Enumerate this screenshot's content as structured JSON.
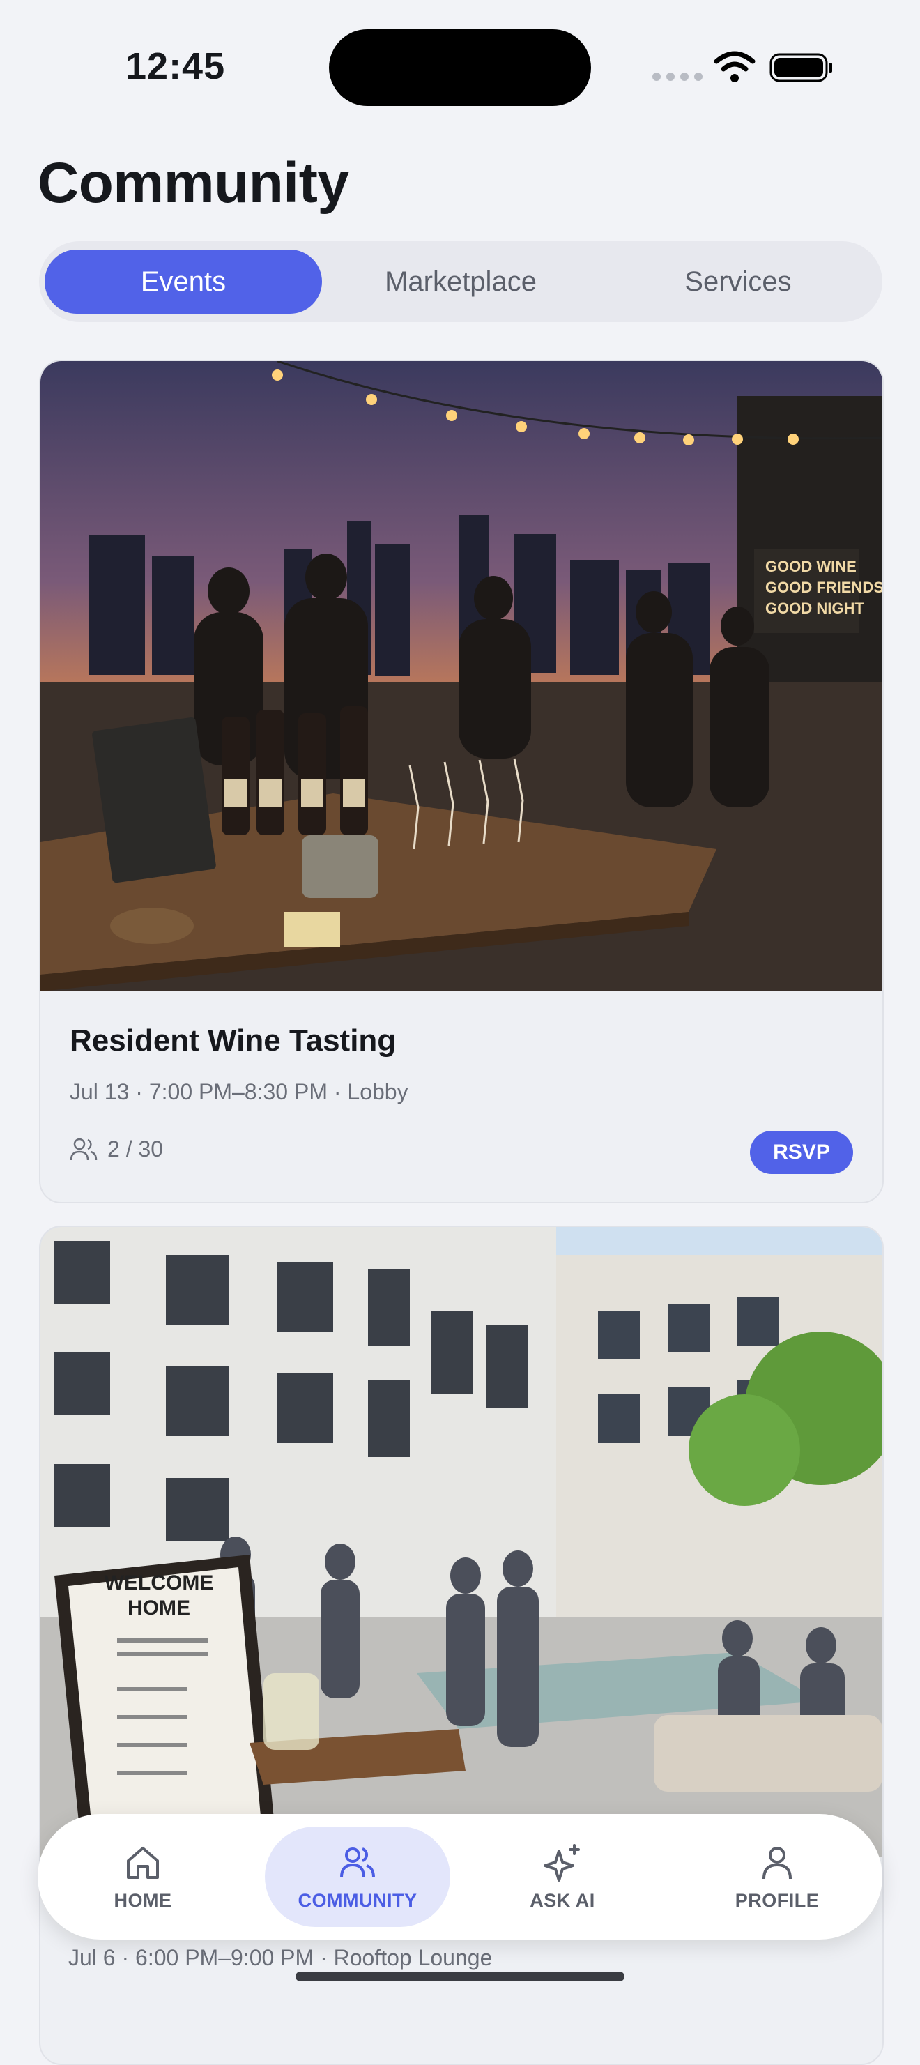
{
  "status_bar": {
    "time": "12:45"
  },
  "page": {
    "title": "Community"
  },
  "tabs": [
    {
      "label": "Events",
      "active": true
    },
    {
      "label": "Marketplace",
      "active": false
    },
    {
      "label": "Services",
      "active": false
    }
  ],
  "events": [
    {
      "title": "Resident Wine Tasting",
      "meta": "Jul 13 · 7:00 PM–8:30 PM · Lobby",
      "attendees": "2 / 30",
      "action": "RSVP",
      "image_text": {
        "sign": [
          "GOOD WINE",
          "GOOD FRIENDS",
          "GOOD NIGHT"
        ]
      }
    },
    {
      "meta": "Jul 6 · 6:00 PM–9:00 PM · Rooftop Lounge",
      "image_text": {
        "sign_title": [
          "WELCOME",
          "HOME"
        ]
      }
    }
  ],
  "bottom_nav": [
    {
      "label": "HOME",
      "icon": "home-icon",
      "active": false
    },
    {
      "label": "COMMUNITY",
      "icon": "people-icon",
      "active": true
    },
    {
      "label": "ASK AI",
      "icon": "sparkle-icon",
      "active": false
    },
    {
      "label": "PROFILE",
      "icon": "person-icon",
      "active": false
    }
  ],
  "colors": {
    "accent": "#5162e8",
    "background": "#f2f3f7",
    "card": "#eef0f4"
  }
}
